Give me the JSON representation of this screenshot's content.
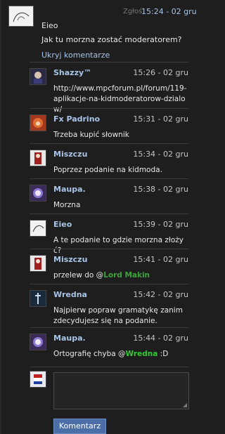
{
  "post": {
    "report_label": "Zgłoś",
    "time": "15:24 - 02 gru",
    "author": "Eieo",
    "text": "Jak tu morzna zostać moderatorem?",
    "toggle_label": "Ukryj komentarze"
  },
  "comments": [
    {
      "author": "Shazzy™",
      "time": "15:26 - 02 gru",
      "text": "http://www.mpcforum.pl/forum/119-aplikacje-na-kidmoderatorow-dzialow/"
    },
    {
      "author": "Fx Padrino",
      "time": "15:31 - 02 gru",
      "text": "Trzeba kupić słownik"
    },
    {
      "author": "Miszczu",
      "time": "15:34 - 02 gru",
      "text": "Poprzez podanie na kidmoda."
    },
    {
      "author": "Maupa.",
      "time": "15:38 - 02 gru",
      "text": "Morzna"
    },
    {
      "author": "Eieo",
      "time": "15:39 - 02 gru",
      "text": "A te podanie to gdzie morzna złożyć?"
    },
    {
      "author": "Miszczu",
      "time": "15:41 - 02 gru",
      "text_before": "przelew do @",
      "mention": "Lord Makin",
      "text_after": ""
    },
    {
      "author": "Wredna",
      "time": "15:42 - 02 gru",
      "text": "Najpierw popraw gramatykę zanim zdecydujesz się na podanie."
    },
    {
      "author": "Maupa.",
      "time": "15:44 - 02 gru",
      "text_before": "Ortografię chyba @",
      "mention": "Wredna",
      "text_after": " :D"
    }
  ],
  "reply": {
    "input_value": "",
    "submit_label": "Komentarz"
  },
  "colors": {
    "accent": "#a9c4e6",
    "button": "#4b6ea8"
  }
}
